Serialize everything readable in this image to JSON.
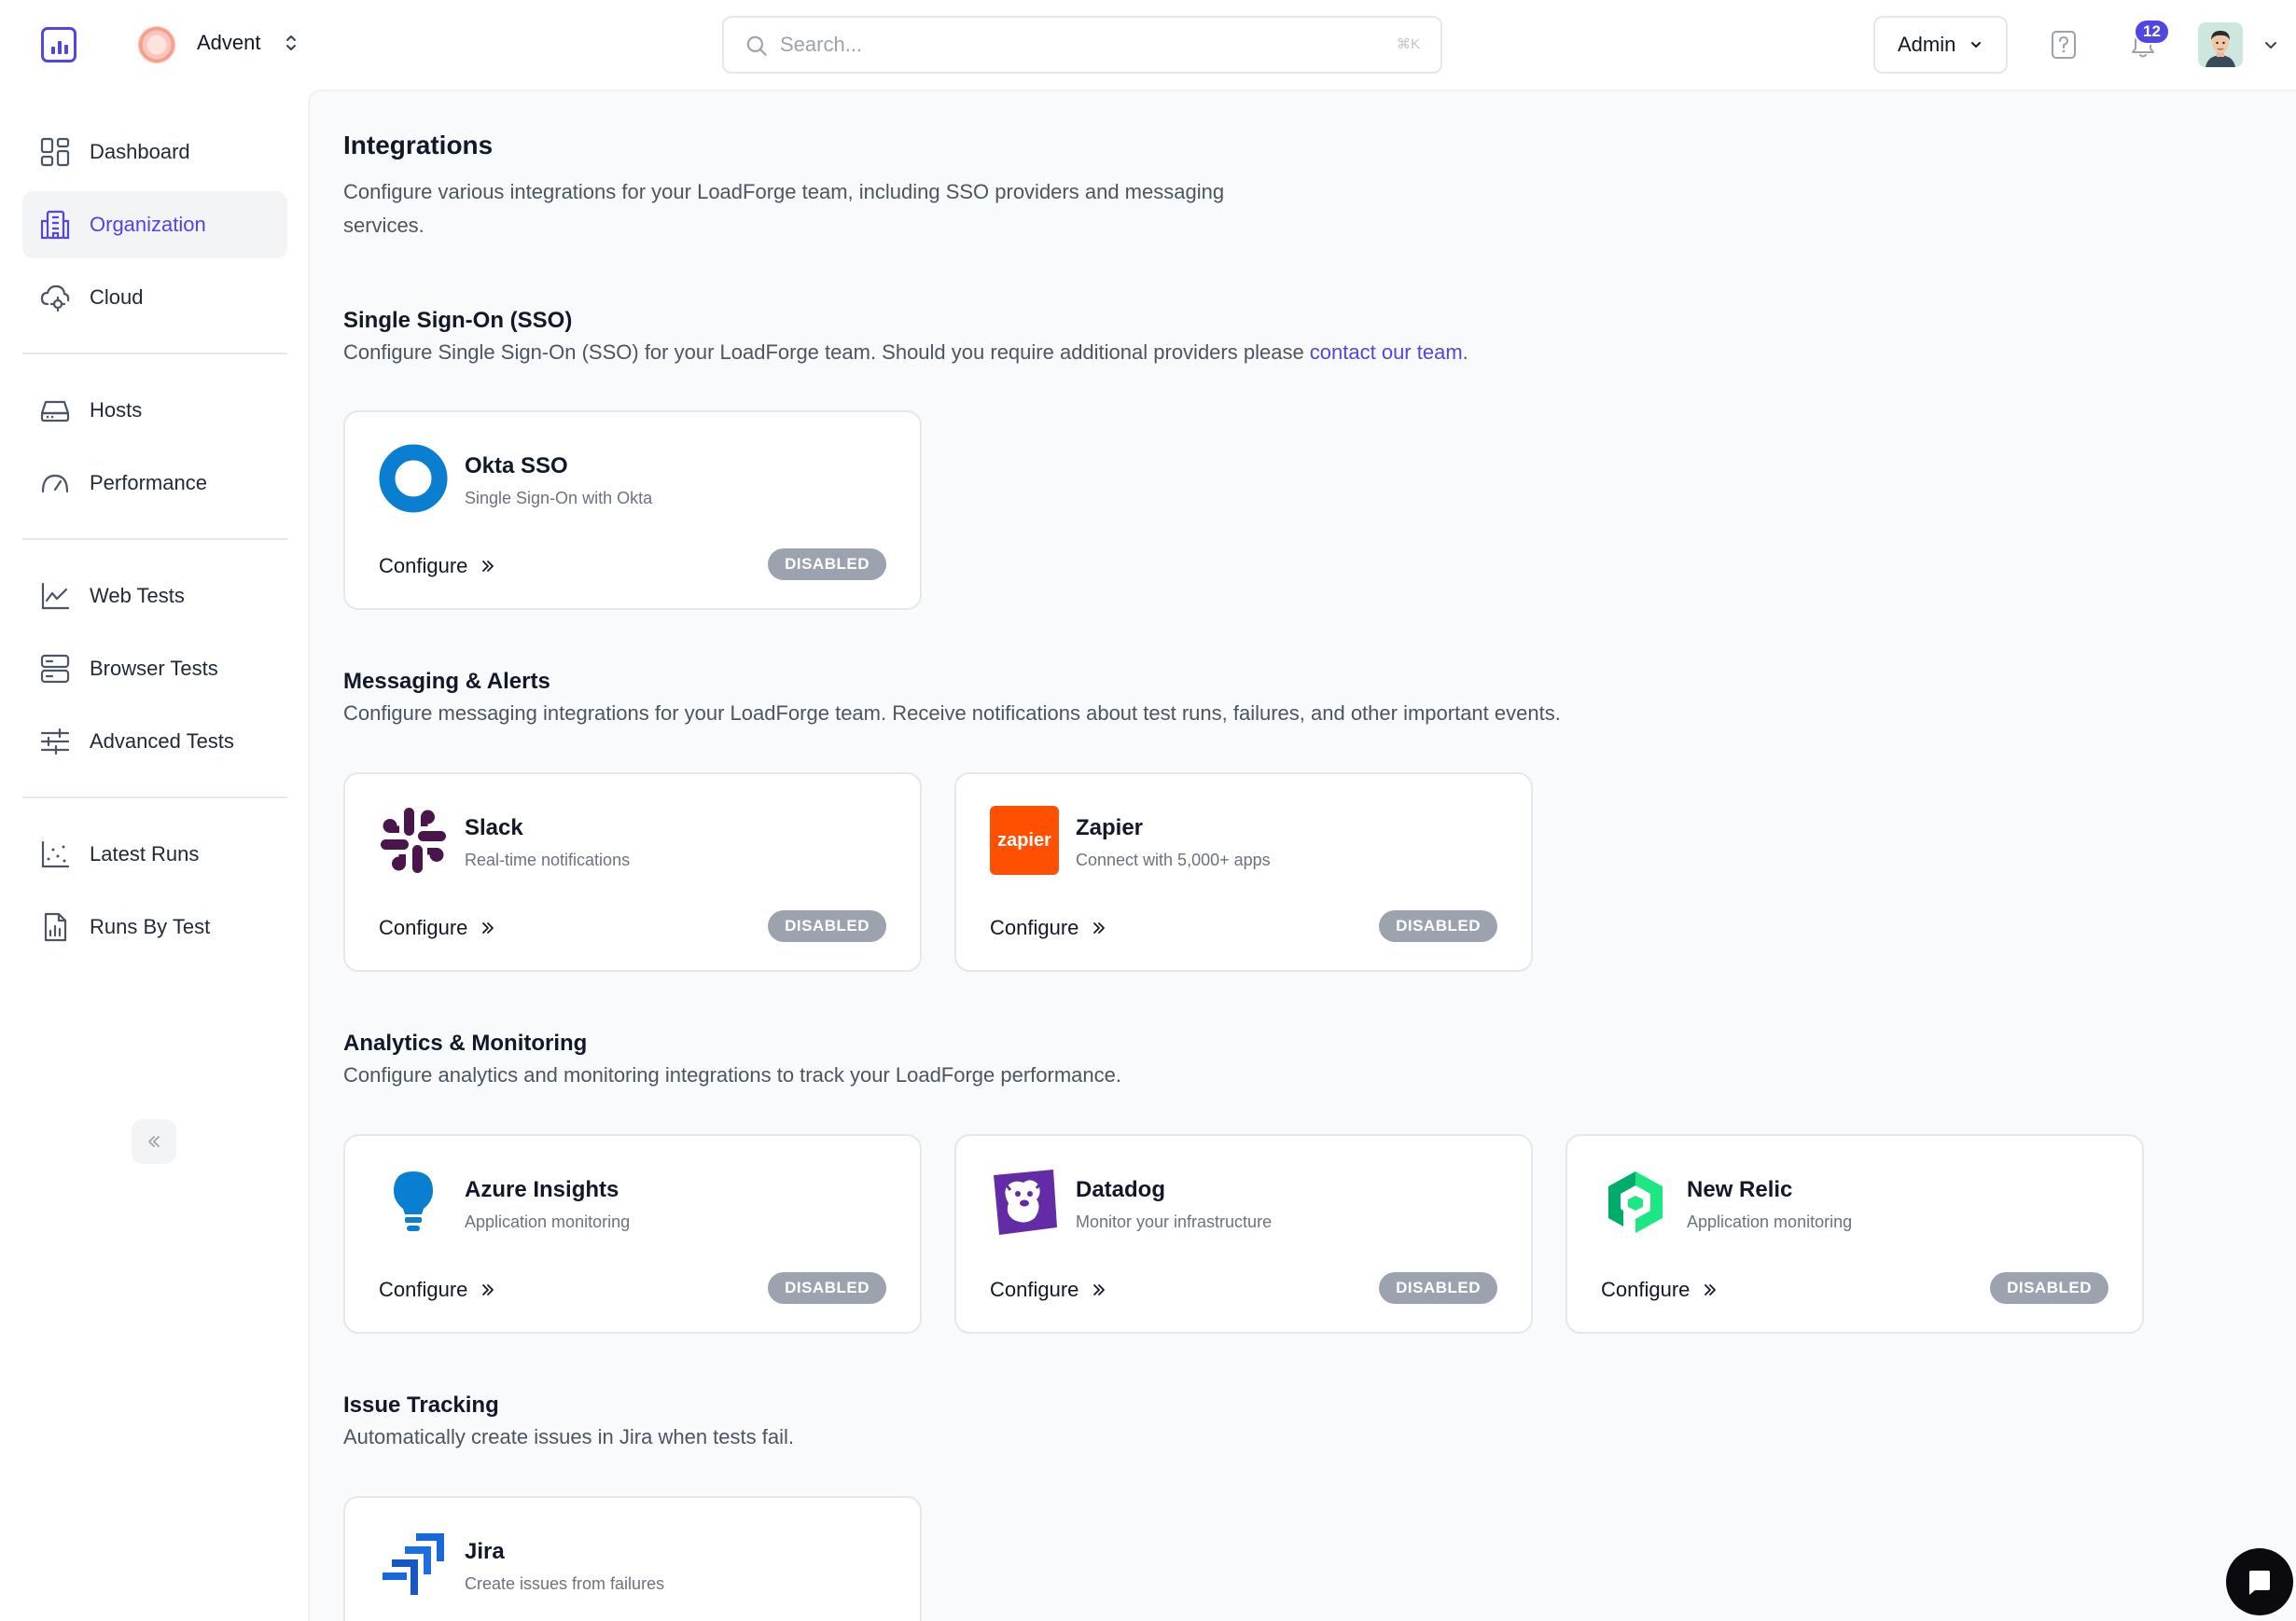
{
  "topbar": {
    "org_name": "Advent",
    "search_placeholder": "Search...",
    "search_shortcut": "⌘K",
    "role_label": "Admin",
    "notification_count": "12"
  },
  "sidebar": {
    "items": [
      {
        "label": "Dashboard",
        "icon": "dashboard-icon",
        "active": false
      },
      {
        "label": "Organization",
        "icon": "building-icon",
        "active": true
      },
      {
        "label": "Cloud",
        "icon": "cloud-icon",
        "active": false
      },
      {
        "label": "Hosts",
        "icon": "server-icon",
        "active": false
      },
      {
        "label": "Performance",
        "icon": "gauge-icon",
        "active": false
      },
      {
        "label": "Web Tests",
        "icon": "line-chart-icon",
        "active": false
      },
      {
        "label": "Browser Tests",
        "icon": "browser-icon",
        "active": false
      },
      {
        "label": "Advanced Tests",
        "icon": "sliders-icon",
        "active": false
      },
      {
        "label": "Latest Runs",
        "icon": "scatter-icon",
        "active": false
      },
      {
        "label": "Runs By Test",
        "icon": "report-icon",
        "active": false
      }
    ]
  },
  "page": {
    "title": "Integrations",
    "description": "Configure various integrations for your LoadForge team, including SSO providers and messaging services."
  },
  "sections": {
    "sso": {
      "title": "Single Sign-On (SSO)",
      "description": "Configure Single Sign-On (SSO) for your LoadForge team. Should you require additional providers please ",
      "link": "contact our team",
      "suffix": "."
    },
    "messaging": {
      "title": "Messaging & Alerts",
      "description": "Configure messaging integrations for your LoadForge team. Receive notifications about test runs, failures, and other important events."
    },
    "analytics": {
      "title": "Analytics & Monitoring",
      "description": "Configure analytics and monitoring integrations to track your LoadForge performance."
    },
    "issues": {
      "title": "Issue Tracking",
      "description": "Automatically create issues in Jira when tests fail."
    }
  },
  "integrations": {
    "okta": {
      "name": "Okta SSO",
      "sub": "Single Sign-On with Okta",
      "action": "Configure",
      "status": "DISABLED"
    },
    "slack": {
      "name": "Slack",
      "sub": "Real-time notifications",
      "action": "Configure",
      "status": "DISABLED"
    },
    "zapier": {
      "name": "Zapier",
      "sub": "Connect with 5,000+ apps",
      "action": "Configure",
      "status": "DISABLED",
      "logo_text": "zapier"
    },
    "azure": {
      "name": "Azure Insights",
      "sub": "Application monitoring",
      "action": "Configure",
      "status": "DISABLED"
    },
    "datadog": {
      "name": "Datadog",
      "sub": "Monitor your infrastructure",
      "action": "Configure",
      "status": "DISABLED"
    },
    "newrelic": {
      "name": "New Relic",
      "sub": "Application monitoring",
      "action": "Configure",
      "status": "DISABLED"
    },
    "jira": {
      "name": "Jira",
      "sub": "Create issues from failures"
    }
  },
  "colors": {
    "accent": "#4f46e5",
    "disabled_badge": "#9ca3af",
    "okta": "#0a7fd1",
    "zapier": "#ff4f00",
    "datadog": "#632ca6",
    "newrelic": "#1ce783",
    "jira": "#1868db"
  }
}
